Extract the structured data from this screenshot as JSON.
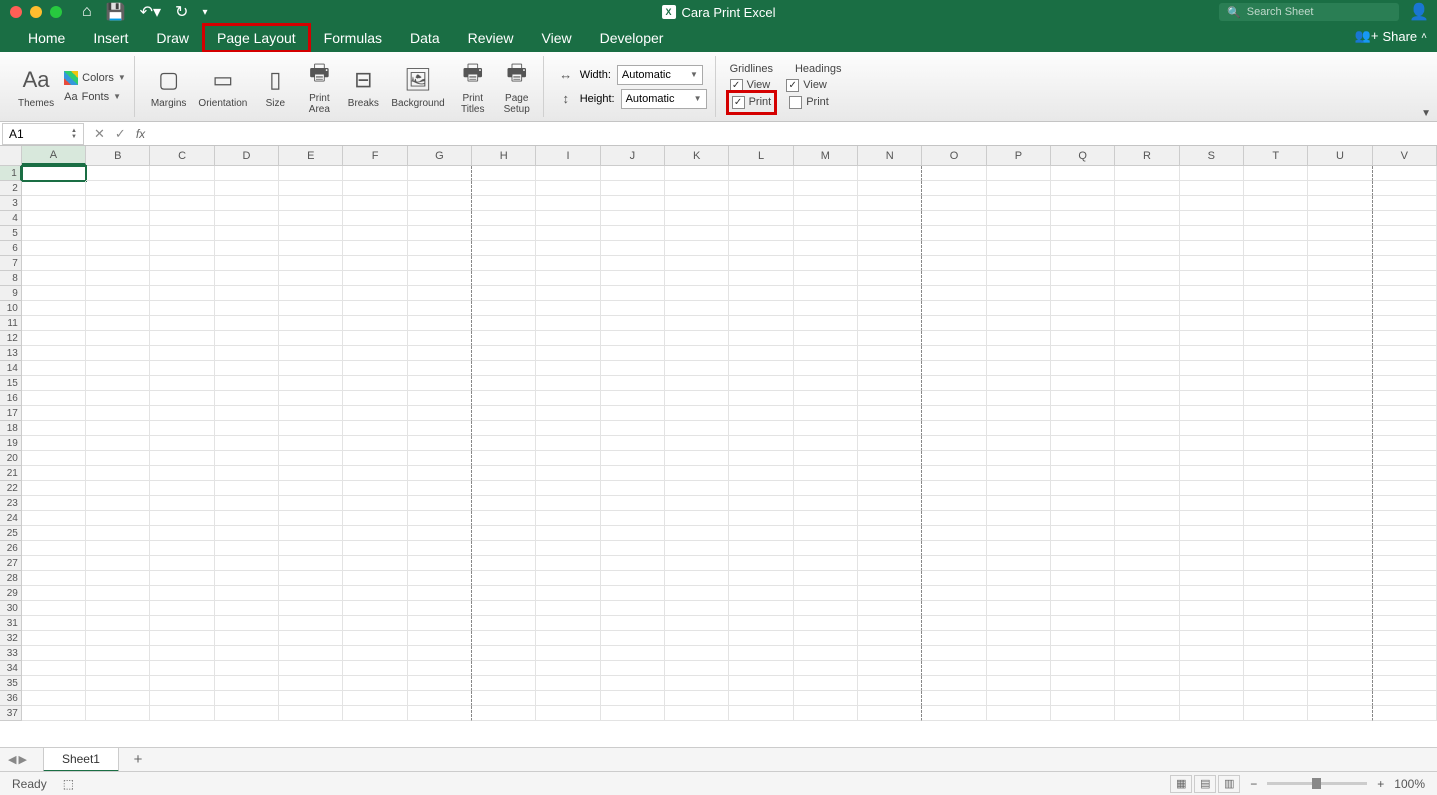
{
  "title": "Cara Print Excel",
  "search_placeholder": "Search Sheet",
  "tabs": [
    "Home",
    "Insert",
    "Draw",
    "Page Layout",
    "Formulas",
    "Data",
    "Review",
    "View",
    "Developer"
  ],
  "active_tab_index": 3,
  "share_label": "Share",
  "ribbon": {
    "themes": "Themes",
    "colors": "Colors",
    "fonts": "Fonts",
    "margins": "Margins",
    "orientation": "Orientation",
    "size": "Size",
    "print_area": "Print\nArea",
    "breaks": "Breaks",
    "background": "Background",
    "print_titles": "Print\nTitles",
    "page_setup": "Page\nSetup",
    "width": "Width:",
    "height": "Height:",
    "width_val": "Automatic",
    "height_val": "Automatic",
    "gridlines": "Gridlines",
    "headings": "Headings",
    "view": "View",
    "print": "Print"
  },
  "name_box": "A1",
  "columns": [
    "A",
    "B",
    "C",
    "D",
    "E",
    "F",
    "G",
    "H",
    "I",
    "J",
    "K",
    "L",
    "M",
    "N",
    "O",
    "P",
    "Q",
    "R",
    "S",
    "T",
    "U",
    "V"
  ],
  "row_count": 37,
  "sheet_tab": "Sheet1",
  "status_text": "Ready",
  "zoom": "100%"
}
